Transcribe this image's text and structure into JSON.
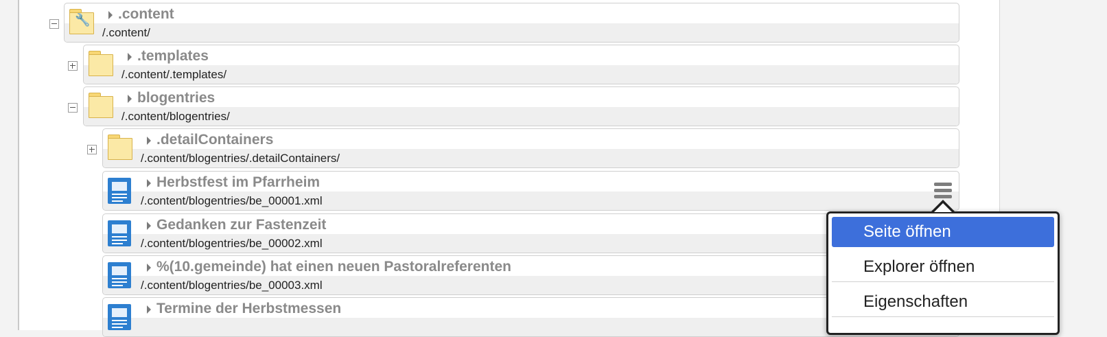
{
  "tree": {
    "items": [
      {
        "title": ".content",
        "path": "/.content/",
        "type": "folder-special",
        "toggle": "minus"
      },
      {
        "title": ".templates",
        "path": "/.content/.templates/",
        "type": "folder",
        "toggle": "plus"
      },
      {
        "title": "blogentries",
        "path": "/.content/blogentries/",
        "type": "folder",
        "toggle": "minus"
      },
      {
        "title": ".detailContainers",
        "path": "/.content/blogentries/.detailContainers/",
        "type": "folder",
        "toggle": "plus"
      },
      {
        "title": "Herbstfest im Pfarrheim",
        "path": "/.content/blogentries/be_00001.xml",
        "type": "document"
      },
      {
        "title": "Gedanken zur Fastenzeit",
        "path": "/.content/blogentries/be_00002.xml",
        "type": "document"
      },
      {
        "title": "%(10.gemeinde) hat einen neuen Pastoralreferenten",
        "path": "/.content/blogentries/be_00003.xml",
        "type": "document"
      },
      {
        "title": "Termine der Herbstmessen",
        "path": "",
        "type": "document"
      }
    ]
  },
  "context_menu": {
    "items": [
      {
        "label": "Seite öffnen",
        "active": true
      },
      {
        "label": "Explorer öffnen",
        "active": false
      },
      {
        "label": "Eigenschaften",
        "active": false
      }
    ]
  },
  "colors": {
    "folder": "#fbe9a6",
    "document": "#2d7fd0",
    "menu_active": "#3d6fdb"
  }
}
